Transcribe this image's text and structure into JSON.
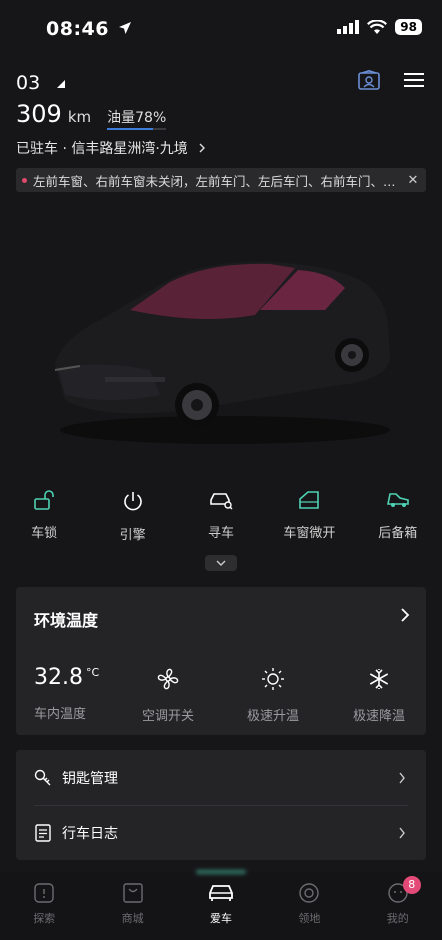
{
  "status": {
    "time": "08:46",
    "battery": "98"
  },
  "header": {
    "car_name": "03",
    "range_value": "309",
    "range_unit": "km",
    "fuel_label": "油量78%",
    "fuel_percent": 78,
    "location": "已驻车 · 信丰路星洲湾·九境",
    "alert_text": "左前车窗、右前车窗未关闭，左前车门、左后车门、右前车门、右…",
    "alert_close": "✕"
  },
  "quick_actions": [
    {
      "label": "车锁",
      "icon": "unlock-icon"
    },
    {
      "label": "引擎",
      "icon": "power-icon"
    },
    {
      "label": "寻车",
      "icon": "find-car-icon"
    },
    {
      "label": "车窗微开",
      "icon": "window-icon"
    },
    {
      "label": "后备箱",
      "icon": "trunk-icon"
    }
  ],
  "env": {
    "title": "环境温度",
    "temp_value": "32.8",
    "temp_unit": "°C",
    "temp_label": "车内温度",
    "controls": [
      {
        "label": "空调开关",
        "icon": "fan-icon"
      },
      {
        "label": "极速升温",
        "icon": "sun-icon"
      },
      {
        "label": "极速降温",
        "icon": "snowflake-icon"
      }
    ]
  },
  "list": {
    "items": [
      {
        "label": "钥匙管理",
        "icon": "key-icon"
      },
      {
        "label": "行车日志",
        "icon": "log-icon"
      }
    ]
  },
  "nav": {
    "items": [
      {
        "label": "探索",
        "icon": "explore-icon"
      },
      {
        "label": "商城",
        "icon": "shop-icon"
      },
      {
        "label": "爱车",
        "icon": "car-icon"
      },
      {
        "label": "领地",
        "icon": "territory-icon"
      },
      {
        "label": "我的",
        "icon": "profile-icon"
      }
    ],
    "active": "爱车",
    "badge": "8"
  },
  "colors": {
    "accent_teal": "#4fd2b3",
    "fuel_blue": "#3d7bd8",
    "alert_red": "#e04a6a",
    "badge_pink": "#e34a78"
  }
}
